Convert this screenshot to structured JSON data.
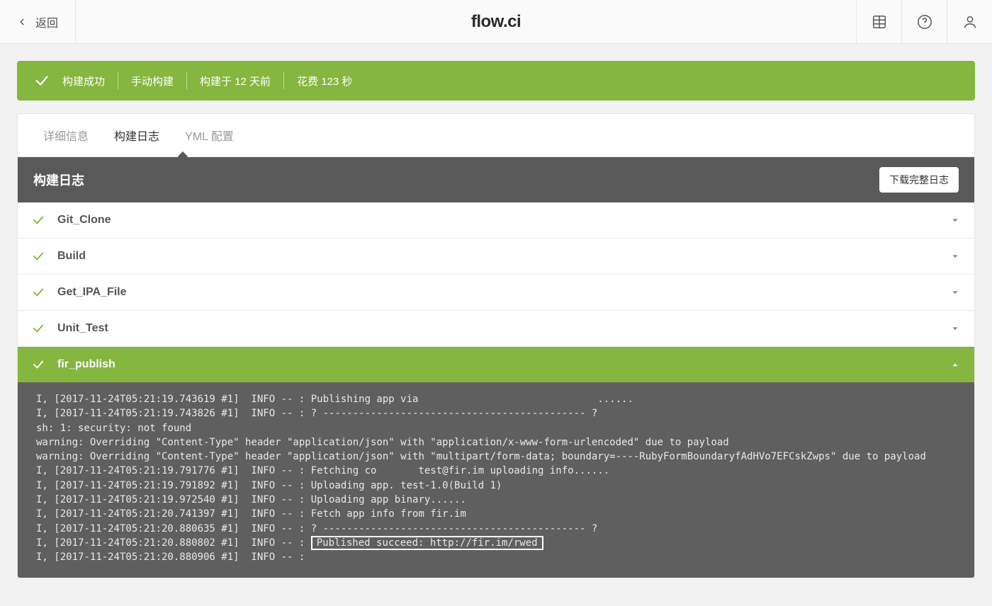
{
  "header": {
    "back_label": "返回",
    "brand": "flow.ci"
  },
  "status": {
    "result": "构建成功",
    "trigger": "手动构建",
    "built_at": "构建于 12 天前",
    "duration": "花费 123 秒"
  },
  "tabs": {
    "details": "详细信息",
    "build_log": "构建日志",
    "yml_config": "YML 配置"
  },
  "panel": {
    "title": "构建日志",
    "download": "下载完整日志"
  },
  "steps": [
    {
      "name": "Git_Clone"
    },
    {
      "name": "Build"
    },
    {
      "name": "Get_IPA_File"
    },
    {
      "name": "Unit_Test"
    },
    {
      "name": "fir_publish"
    }
  ],
  "log": {
    "pre": "I, [2017-11-24T05:21:19.743619 #1]  INFO -- : Publishing app via                              ......\nI, [2017-11-24T05:21:19.743826 #1]  INFO -- : ? -------------------------------------------- ?\nsh: 1: security: not found\nwarning: Overriding \"Content-Type\" header \"application/json\" with \"application/x-www-form-urlencoded\" due to payload\nwarning: Overriding \"Content-Type\" header \"application/json\" with \"multipart/form-data; boundary=----RubyFormBoundaryfAdHVo7EFCskZwps\" due to payload\nI, [2017-11-24T05:21:19.791776 #1]  INFO -- : Fetching co       test@fir.im uploading info......\nI, [2017-11-24T05:21:19.791892 #1]  INFO -- : Uploading app. test-1.0(Build 1)\nI, [2017-11-24T05:21:19.972540 #1]  INFO -- : Uploading app binary......\nI, [2017-11-24T05:21:20.741397 #1]  INFO -- : Fetch app info from fir.im\nI, [2017-11-24T05:21:20.880635 #1]  INFO -- : ? -------------------------------------------- ?",
    "highlight_prefix": "I, [2017-11-24T05:21:20.880802 #1]  INFO -- : ",
    "highlight": "Published succeed: http://fir.im/rwed",
    "post": "I, [2017-11-24T05:21:20.880906 #1]  INFO -- :"
  }
}
